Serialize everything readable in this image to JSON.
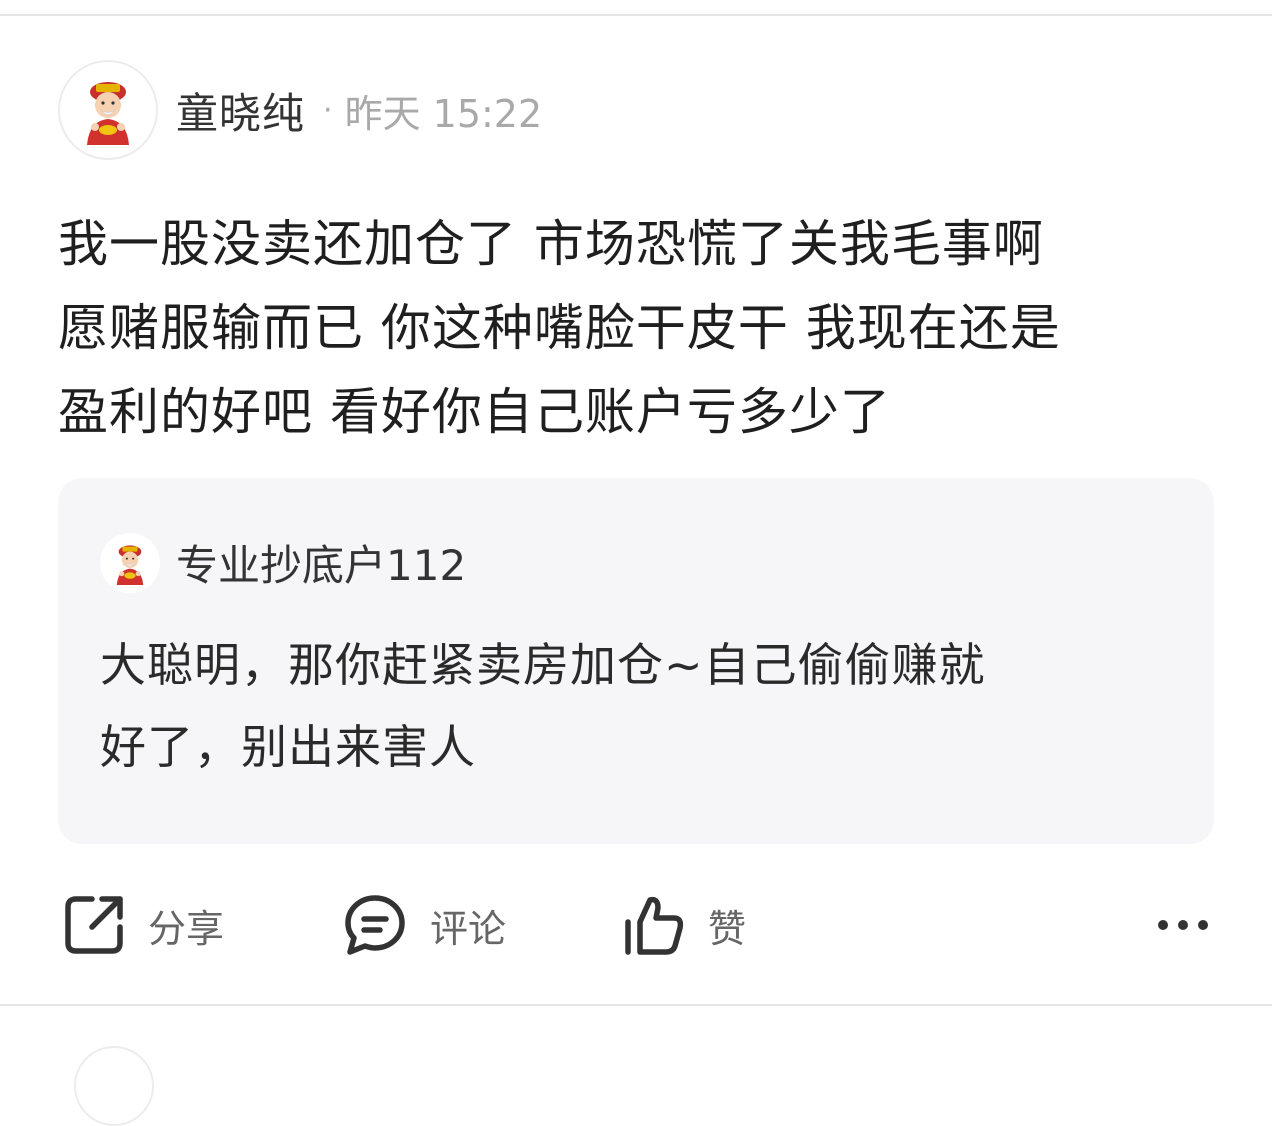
{
  "post": {
    "author": {
      "name": "童晓纯",
      "avatar": "caishen-avatar-icon"
    },
    "meta_separator": "·",
    "time": "昨天 15:22",
    "body": "我一股没卖还加仓了 市场恐慌了关我毛事啊\n愿赌服输而已 你这种嘴脸干皮干 我现在还是\n盈利的好吧 看好你自己账户亏多少了"
  },
  "quote": {
    "author": {
      "name": "专业抄底户112",
      "avatar": "caishen-avatar-icon"
    },
    "body": "大聪明，那你赶紧卖房加仓~自己偷偷赚就\n好了，别出来害人"
  },
  "actions": {
    "share_label": "分享",
    "comment_label": "评论",
    "like_label": "赞",
    "share_icon": "share-icon",
    "comment_icon": "comment-icon",
    "like_icon": "thumbs-up-icon",
    "more_icon": "more-dots-icon"
  },
  "colors": {
    "text_primary": "#1f1f1f",
    "text_secondary": "#a9a9a9",
    "icon": "#333333",
    "quote_background": "#f6f6f8",
    "divider": "#e6e6e6"
  }
}
